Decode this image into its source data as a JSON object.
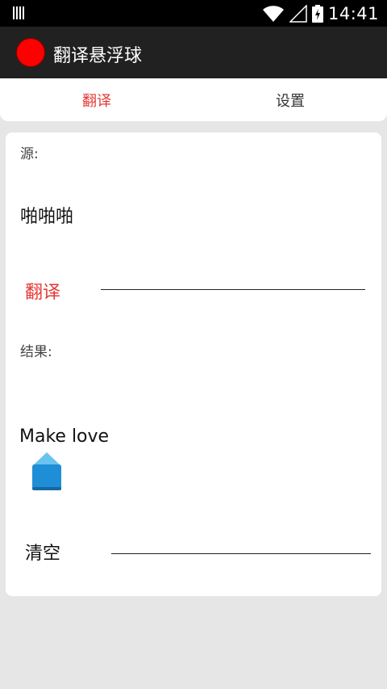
{
  "status_bar": {
    "time": "14:41"
  },
  "app_bar": {
    "title": "翻译悬浮球",
    "icon_color": "#ff0000"
  },
  "tabs": [
    {
      "label": "翻译",
      "active": true
    },
    {
      "label": "设置",
      "active": false
    }
  ],
  "translate": {
    "source_label": "源:",
    "source_text": "啪啪啪",
    "translate_button": "翻译",
    "result_label": "结果:",
    "result_text": "Make love",
    "clear_button": "清空"
  },
  "colors": {
    "accent": "#e53935",
    "handle": "#1e8fd6"
  }
}
